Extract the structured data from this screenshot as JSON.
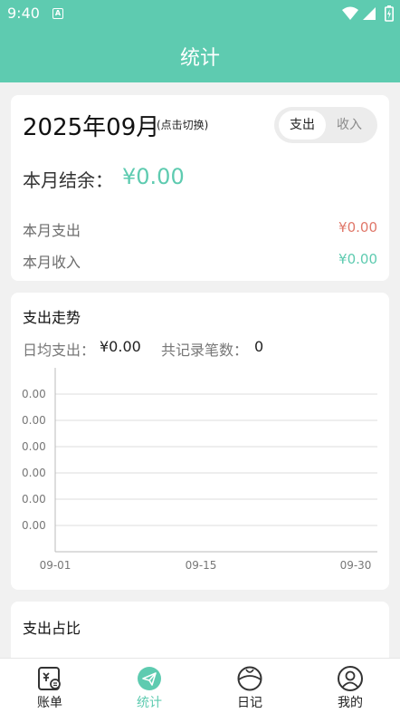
{
  "status_bar": {
    "time": "9:40",
    "notification_icon": "a-icon"
  },
  "app_bar": {
    "title": "统计"
  },
  "summary": {
    "month": "2025年09月",
    "month_hint": "(点击切换)",
    "toggle": {
      "expense": "支出",
      "income": "收入",
      "selected": "支出"
    },
    "balance_label": "本月结余：",
    "balance_value": "¥0.00",
    "expense_label": "本月支出",
    "expense_value": "¥0.00",
    "income_label": "本月收入",
    "income_value": "¥0.00",
    "colors": {
      "accent": "#5ecbb0",
      "expense": "#e0786a",
      "income": "#5ecbb0"
    }
  },
  "trend": {
    "title": "支出走势",
    "daily_avg_label": "日均支出：",
    "daily_avg_value": "¥0.00",
    "count_label": "共记录笔数：",
    "count_value": "0"
  },
  "chart_data": {
    "type": "line",
    "title": "",
    "xlabel": "",
    "ylabel": "",
    "x_ticks": [
      "09-01",
      "09-15",
      "09-30"
    ],
    "y_ticks": [
      "0.00",
      "0.00",
      "0.00",
      "0.00",
      "0.00",
      "0.00"
    ],
    "series": [],
    "grid": true
  },
  "share": {
    "title": "支出占比"
  },
  "tab_bar": {
    "items": [
      {
        "label": "账单",
        "icon": "bill-icon",
        "active": false
      },
      {
        "label": "统计",
        "icon": "send-icon",
        "active": true
      },
      {
        "label": "日记",
        "icon": "diary-icon",
        "active": false
      },
      {
        "label": "我的",
        "icon": "profile-icon",
        "active": false
      }
    ]
  }
}
